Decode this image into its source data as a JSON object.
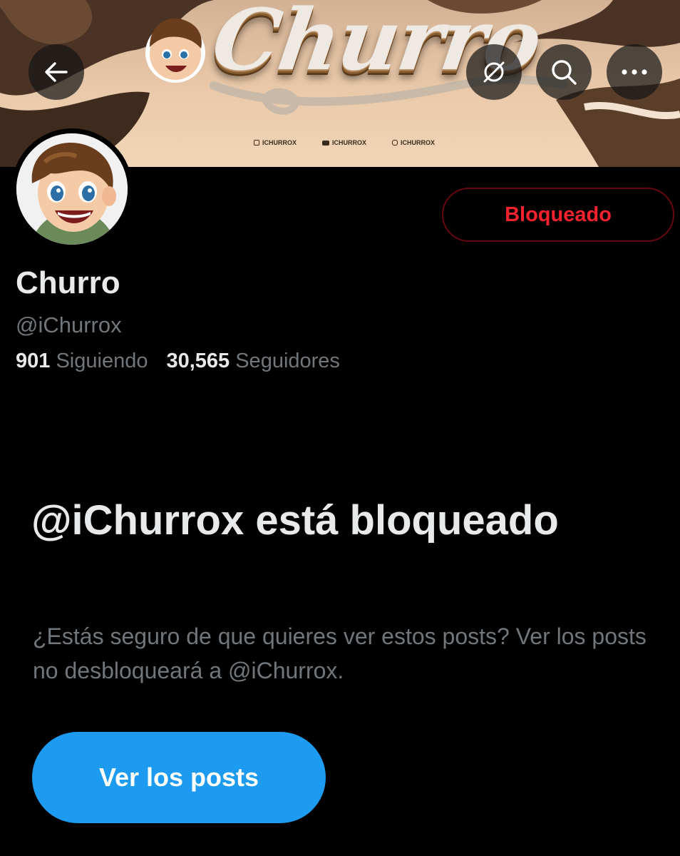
{
  "banner": {
    "title": "Churro",
    "socials": [
      "ICHURROX",
      "ICHURROX",
      "ICHURROX"
    ]
  },
  "header": {
    "back_icon": "arrow-left-icon",
    "grok_icon": "circle-slash-icon",
    "search_icon": "search-icon",
    "more_icon": "more-dots-icon"
  },
  "profile": {
    "display_name": "Churro",
    "handle": "@iChurrox",
    "following_count": "901",
    "following_label": "Siguiendo",
    "followers_count": "30,565",
    "followers_label": "Seguidores",
    "blocked_button": "Bloqueado"
  },
  "blocked_notice": {
    "title": "@iChurrox está bloqueado",
    "body": "¿Estás seguro de que quieres ver estos posts? Ver los posts no desbloqueará a @iChurrox.",
    "view_button": "Ver los posts"
  },
  "colors": {
    "background": "#000000",
    "accent_blue": "#1d9bf0",
    "danger_red": "#f4212e",
    "muted_text": "#71767b",
    "primary_text": "#e7e9ea"
  }
}
